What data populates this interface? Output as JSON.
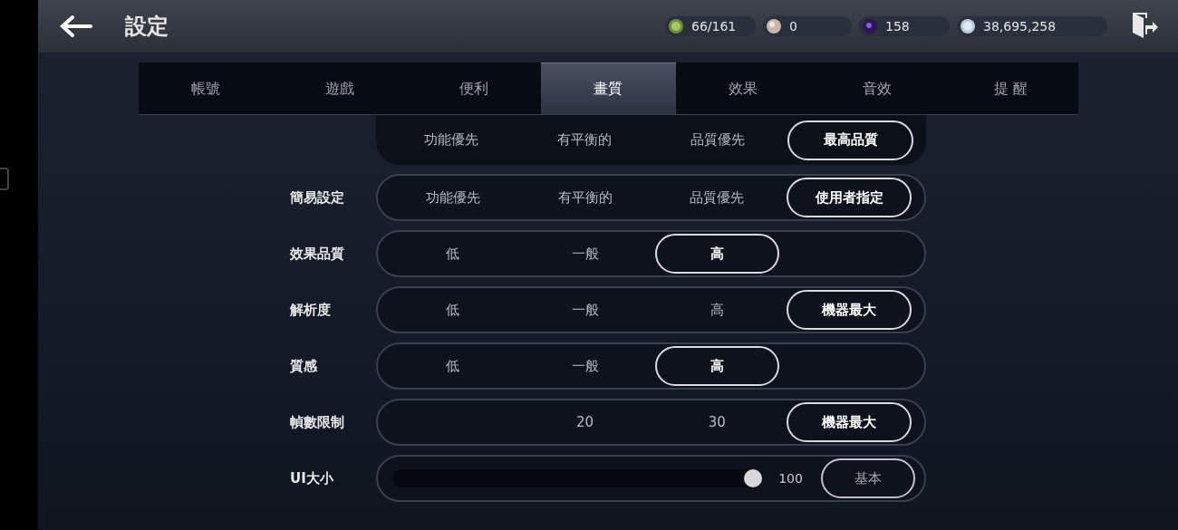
{
  "header": {
    "title": "設定"
  },
  "currencies": [
    {
      "kind": "energy",
      "value": "66/161"
    },
    {
      "kind": "pearl",
      "value": "0"
    },
    {
      "kind": "orb",
      "value": "158"
    },
    {
      "kind": "silver",
      "value": "38,695,258"
    }
  ],
  "tabs": [
    {
      "label": "帳號",
      "selected": false
    },
    {
      "label": "遊戲",
      "selected": false
    },
    {
      "label": "便利",
      "selected": false
    },
    {
      "label": "畫質",
      "selected": true
    },
    {
      "label": "效果",
      "selected": false
    },
    {
      "label": "音效",
      "selected": false
    },
    {
      "label": "提 醒",
      "selected": false
    }
  ],
  "rows": [
    {
      "kind": "preset",
      "right_aligned": false,
      "options": [
        {
          "label": "功能優先",
          "selected": false
        },
        {
          "label": "有平衡的",
          "selected": false
        },
        {
          "label": "品質優先",
          "selected": false
        },
        {
          "label": "最高品質",
          "selected": true
        }
      ]
    },
    {
      "kind": "segmented",
      "label": "簡易設定",
      "right_aligned": false,
      "options": [
        {
          "label": "功能優先",
          "selected": false
        },
        {
          "label": "有平衡的",
          "selected": false
        },
        {
          "label": "品質優先",
          "selected": false
        },
        {
          "label": "使用者指定",
          "selected": true
        }
      ]
    },
    {
      "kind": "segmented",
      "label": "效果品質",
      "right_aligned": false,
      "options": [
        {
          "label": "低",
          "selected": false
        },
        {
          "label": "一般",
          "selected": false
        },
        {
          "label": "高",
          "selected": true
        }
      ]
    },
    {
      "kind": "segmented",
      "label": "解析度",
      "right_aligned": false,
      "options": [
        {
          "label": "低",
          "selected": false
        },
        {
          "label": "一般",
          "selected": false
        },
        {
          "label": "高",
          "selected": false
        },
        {
          "label": "機器最大",
          "selected": true
        }
      ]
    },
    {
      "kind": "segmented",
      "label": "質感",
      "right_aligned": false,
      "options": [
        {
          "label": "低",
          "selected": false
        },
        {
          "label": "一般",
          "selected": false
        },
        {
          "label": "高",
          "selected": true
        }
      ]
    },
    {
      "kind": "segmented",
      "label": "幀數限制",
      "right_aligned": true,
      "options": [
        {
          "label": "20",
          "selected": false
        },
        {
          "label": "30",
          "selected": false
        },
        {
          "label": "機器最大",
          "selected": true
        }
      ]
    },
    {
      "kind": "slider",
      "label": "UI大小",
      "level": 0.98,
      "reading": "100",
      "button": "基本"
    }
  ]
}
